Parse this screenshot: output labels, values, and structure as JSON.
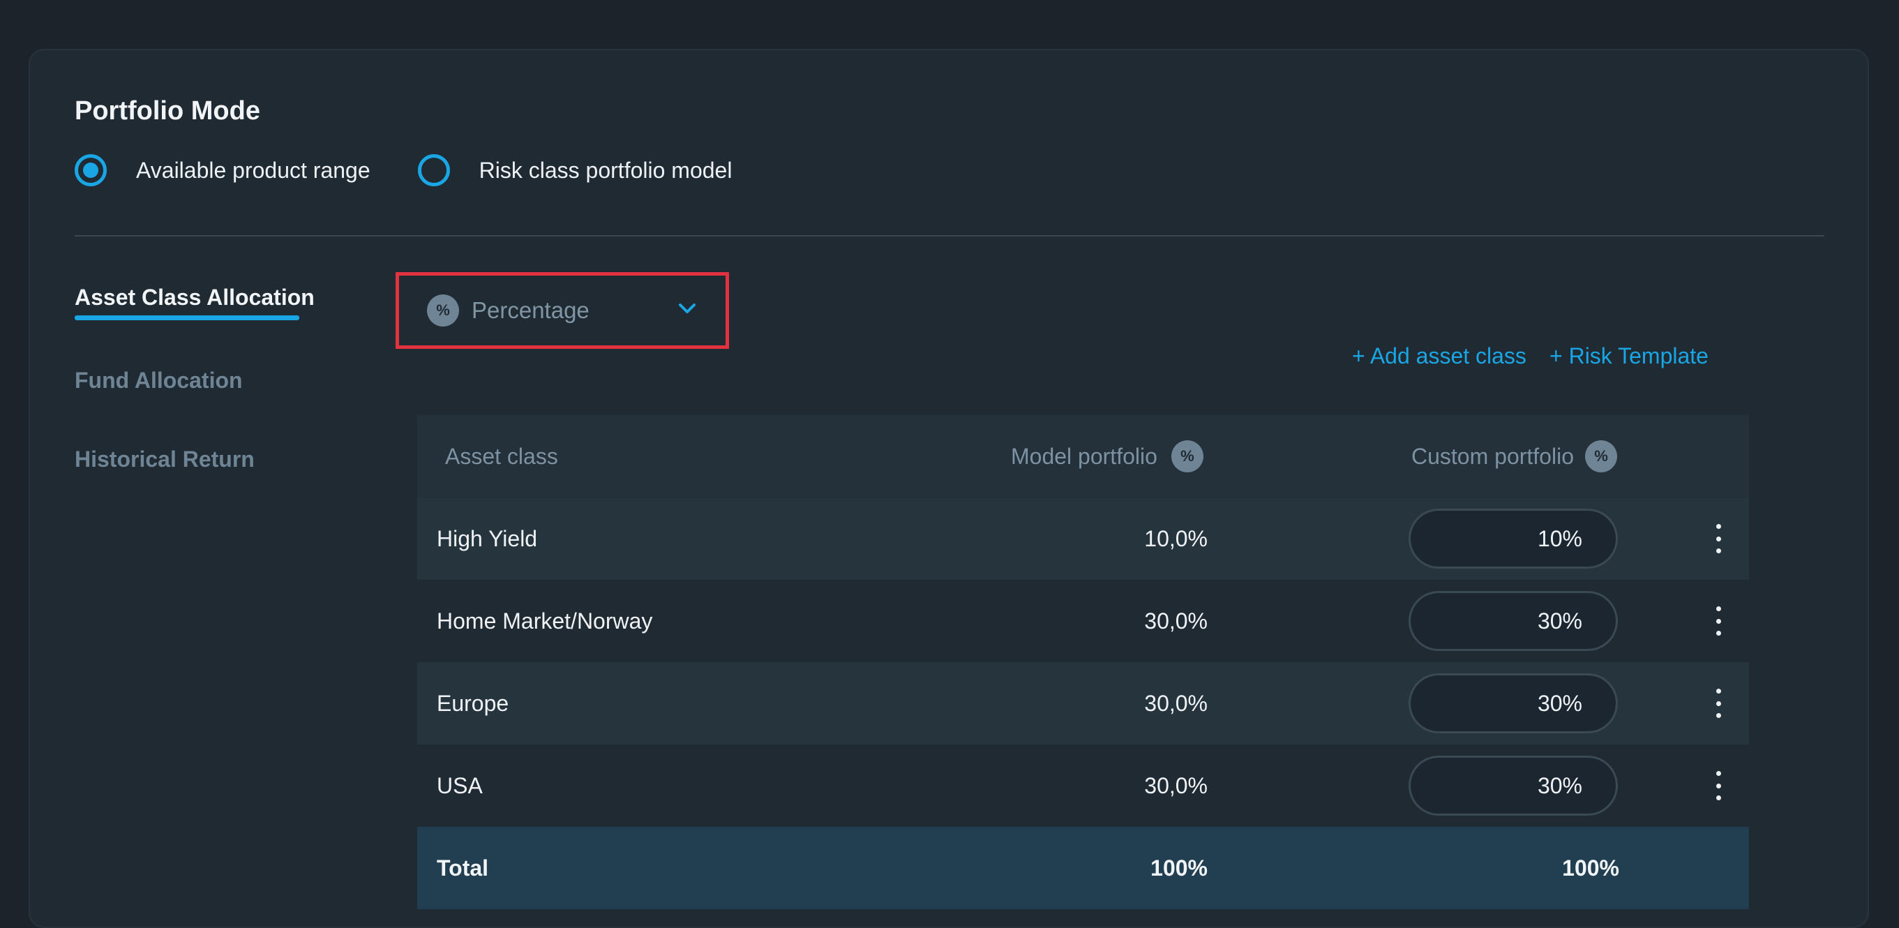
{
  "colors": {
    "accent": "#1aa6e4",
    "highlight_border": "#e0333f",
    "background": "#1c232b",
    "card": "#1f2a33"
  },
  "portfolio_mode": {
    "title": "Portfolio Mode",
    "options": [
      {
        "label": "Available product range",
        "selected": true
      },
      {
        "label": "Risk class portfolio model",
        "selected": false
      }
    ]
  },
  "sidenav": {
    "items": [
      {
        "label": "Asset Class Allocation",
        "active": true
      },
      {
        "label": "Fund Allocation",
        "active": false
      },
      {
        "label": "Historical Return",
        "active": false
      }
    ]
  },
  "toolbar": {
    "unit_dropdown": {
      "icon": "percent-icon",
      "icon_glyph": "%",
      "value": "Percentage"
    },
    "add_asset_class": "+ Add asset class",
    "risk_template": "+ Risk Template"
  },
  "table": {
    "headers": {
      "asset_class": "Asset class",
      "model_portfolio": "Model portfolio",
      "custom_portfolio": "Custom portfolio",
      "unit_glyph": "%"
    },
    "rows": [
      {
        "asset_class": "High Yield",
        "model": "10,0%",
        "custom": "10%"
      },
      {
        "asset_class": "Home Market/Norway",
        "model": "30,0%",
        "custom": "30%"
      },
      {
        "asset_class": "Europe",
        "model": "30,0%",
        "custom": "30%"
      },
      {
        "asset_class": "USA",
        "model": "30,0%",
        "custom": "30%"
      }
    ],
    "total": {
      "label": "Total",
      "model": "100%",
      "custom": "100%"
    }
  }
}
